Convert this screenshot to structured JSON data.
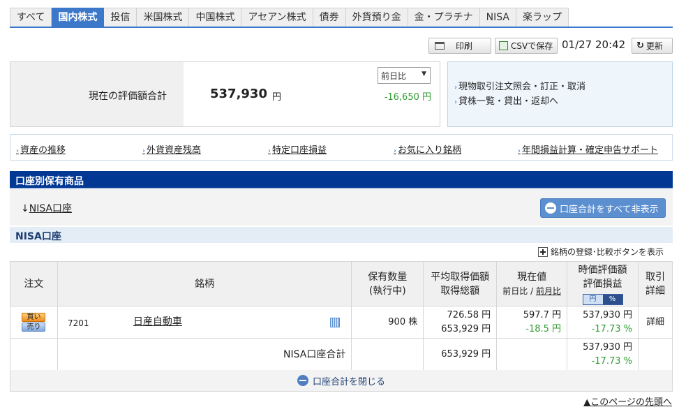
{
  "tabs": [
    "すべて",
    "国内株式",
    "投信",
    "米国株式",
    "中国株式",
    "アセアン株式",
    "債券",
    "外貨預り金",
    "金・プラチナ",
    "NISA",
    "楽ラップ"
  ],
  "active_tab": "国内株式",
  "toolbar": {
    "print": "印刷",
    "csv": "CSVで保存",
    "timestamp": "01/27 20:42",
    "refresh": "更新"
  },
  "summary": {
    "label": "現在の評価額合計",
    "value": "537,930",
    "unit": "円",
    "compare_select": "前日比",
    "diff": "-16,650 円"
  },
  "side_links": [
    "現物取引注文照会・訂正・取消",
    "貸株一覧・貸出・返却へ"
  ],
  "nav_links": [
    "資産の推移",
    "外貨資産残高",
    "特定口座損益",
    "お気に入り銘柄",
    "年間損益計算・確定申告サポート"
  ],
  "section_title": "口座別保有商品",
  "account_link": "NISA口座",
  "hide_all_button": "口座合計をすべて非表示",
  "account_header": "NISA口座",
  "register_button": "銘柄の登録･比較ボタンを表示",
  "table": {
    "headers": {
      "order": "注文",
      "name": "銘柄",
      "qty1": "保有数量",
      "qty2": "(執行中)",
      "avg1": "平均取得価額",
      "avg2": "取得総額",
      "cur1": "現在値",
      "cur2a": "前日比",
      "cur2sep": " / ",
      "cur2b": "前月比",
      "val1": "時価評価額",
      "val2": "評価損益",
      "toggle_yen": "円",
      "toggle_pct": "%",
      "hist1": "取引",
      "hist2": "詳細"
    },
    "row": {
      "buy": "買い",
      "sell": "売り",
      "code": "7201",
      "name": "日産自動車",
      "qty": "900 株",
      "avg_price": "726.58 円",
      "total_cost": "653,929 円",
      "price": "597.7 円",
      "change": "-18.5 円",
      "value": "537,930 円",
      "pl": "-17.73 %",
      "detail": "詳細"
    },
    "total_row": {
      "label": "NISA口座合計",
      "total_cost": "653,929 円",
      "value": "537,930 円",
      "pl": "-17.73 %"
    }
  },
  "close_button": "口座合計を閉じる",
  "page_top": "▲このページの先頭へ"
}
